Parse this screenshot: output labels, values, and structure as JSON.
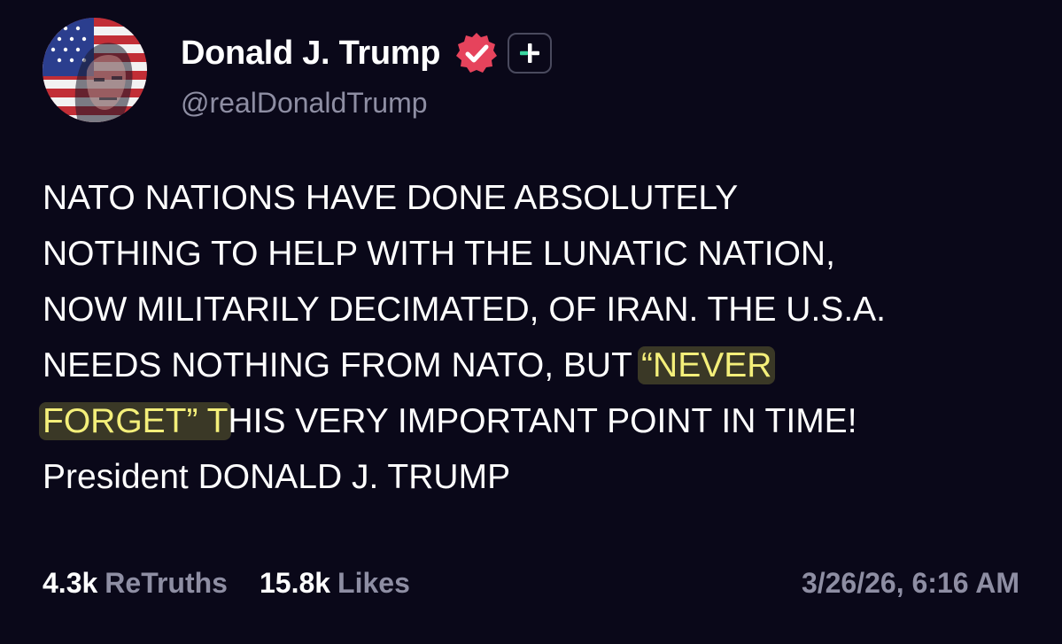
{
  "author": {
    "display_name": "Donald J. Trump",
    "handle": "@realDonaldTrump",
    "verified": true,
    "verified_badge_color": "#e6435c"
  },
  "post": {
    "lines": [
      {
        "before": "NATO NATIONS HAVE DONE ABSOLUTELY",
        "highlight": "",
        "after": ""
      },
      {
        "before": "NOTHING TO HELP WITH THE LUNATIC NATION,",
        "highlight": "",
        "after": ""
      },
      {
        "before": "NOW MILITARILY DECIMATED, OF IRAN. THE U.S.A.",
        "highlight": "",
        "after": ""
      },
      {
        "before": "NEEDS NOTHING FROM NATO, BUT ",
        "highlight": "“NEVER",
        "after": ""
      },
      {
        "before": "",
        "highlight": "FORGET” T",
        "after": "HIS VERY IMPORTANT POINT IN TIME!"
      },
      {
        "before": "President DONALD J. TRUMP",
        "highlight": "",
        "after": ""
      }
    ],
    "highlight_color": "#f4ef7a"
  },
  "stats": {
    "retruths_count": "4.3k",
    "retruths_label": "ReTruths",
    "likes_count": "15.8k",
    "likes_label": "Likes"
  },
  "timestamp": "3/26/26, 6:16 AM",
  "icons": {
    "avatar": "profile-photo",
    "verified": "verified-badge-icon",
    "follow": "plus-icon"
  },
  "colors": {
    "background": "#0a0819",
    "muted_text": "#8e8ea3",
    "accent_green": "#3ad6a0"
  }
}
